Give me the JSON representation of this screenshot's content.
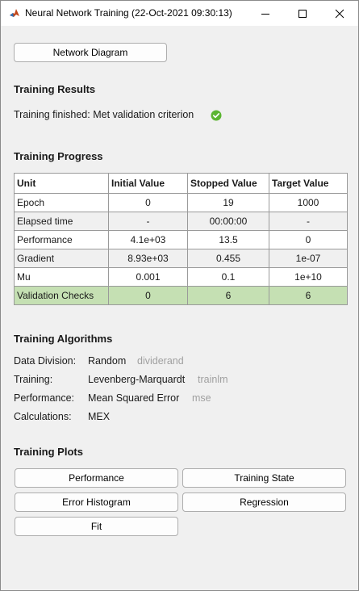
{
  "window": {
    "title": "Neural Network Training (22-Oct-2021 09:30:13)"
  },
  "network_diagram_button": "Network Diagram",
  "results": {
    "heading": "Training Results",
    "status": "Training finished: Met validation criterion"
  },
  "progress": {
    "heading": "Training Progress",
    "columns": [
      "Unit",
      "Initial Value",
      "Stopped Value",
      "Target Value"
    ],
    "rows": [
      {
        "unit": "Epoch",
        "initial": "0",
        "stopped": "19",
        "target": "1000"
      },
      {
        "unit": "Elapsed time",
        "initial": "-",
        "stopped": "00:00:00",
        "target": "-"
      },
      {
        "unit": "Performance",
        "initial": "4.1e+03",
        "stopped": "13.5",
        "target": "0"
      },
      {
        "unit": "Gradient",
        "initial": "8.93e+03",
        "stopped": "0.455",
        "target": "1e-07"
      },
      {
        "unit": "Mu",
        "initial": "0.001",
        "stopped": "0.1",
        "target": "1e+10"
      },
      {
        "unit": "Validation Checks",
        "initial": "0",
        "stopped": "6",
        "target": "6"
      }
    ]
  },
  "algorithms": {
    "heading": "Training Algorithms",
    "items": [
      {
        "label": "Data Division:",
        "value": "Random",
        "fn": "dividerand"
      },
      {
        "label": "Training:",
        "value": "Levenberg-Marquardt",
        "fn": "trainlm"
      },
      {
        "label": "Performance:",
        "value": "Mean Squared Error",
        "fn": "mse"
      },
      {
        "label": "Calculations:",
        "value": "MEX",
        "fn": ""
      }
    ]
  },
  "plots": {
    "heading": "Training Plots",
    "buttons": [
      "Performance",
      "Training State",
      "Error Histogram",
      "Regression",
      "Fit"
    ]
  },
  "colors": {
    "validation_row": "#c5e0b3",
    "success_icon": "#5bb531"
  }
}
